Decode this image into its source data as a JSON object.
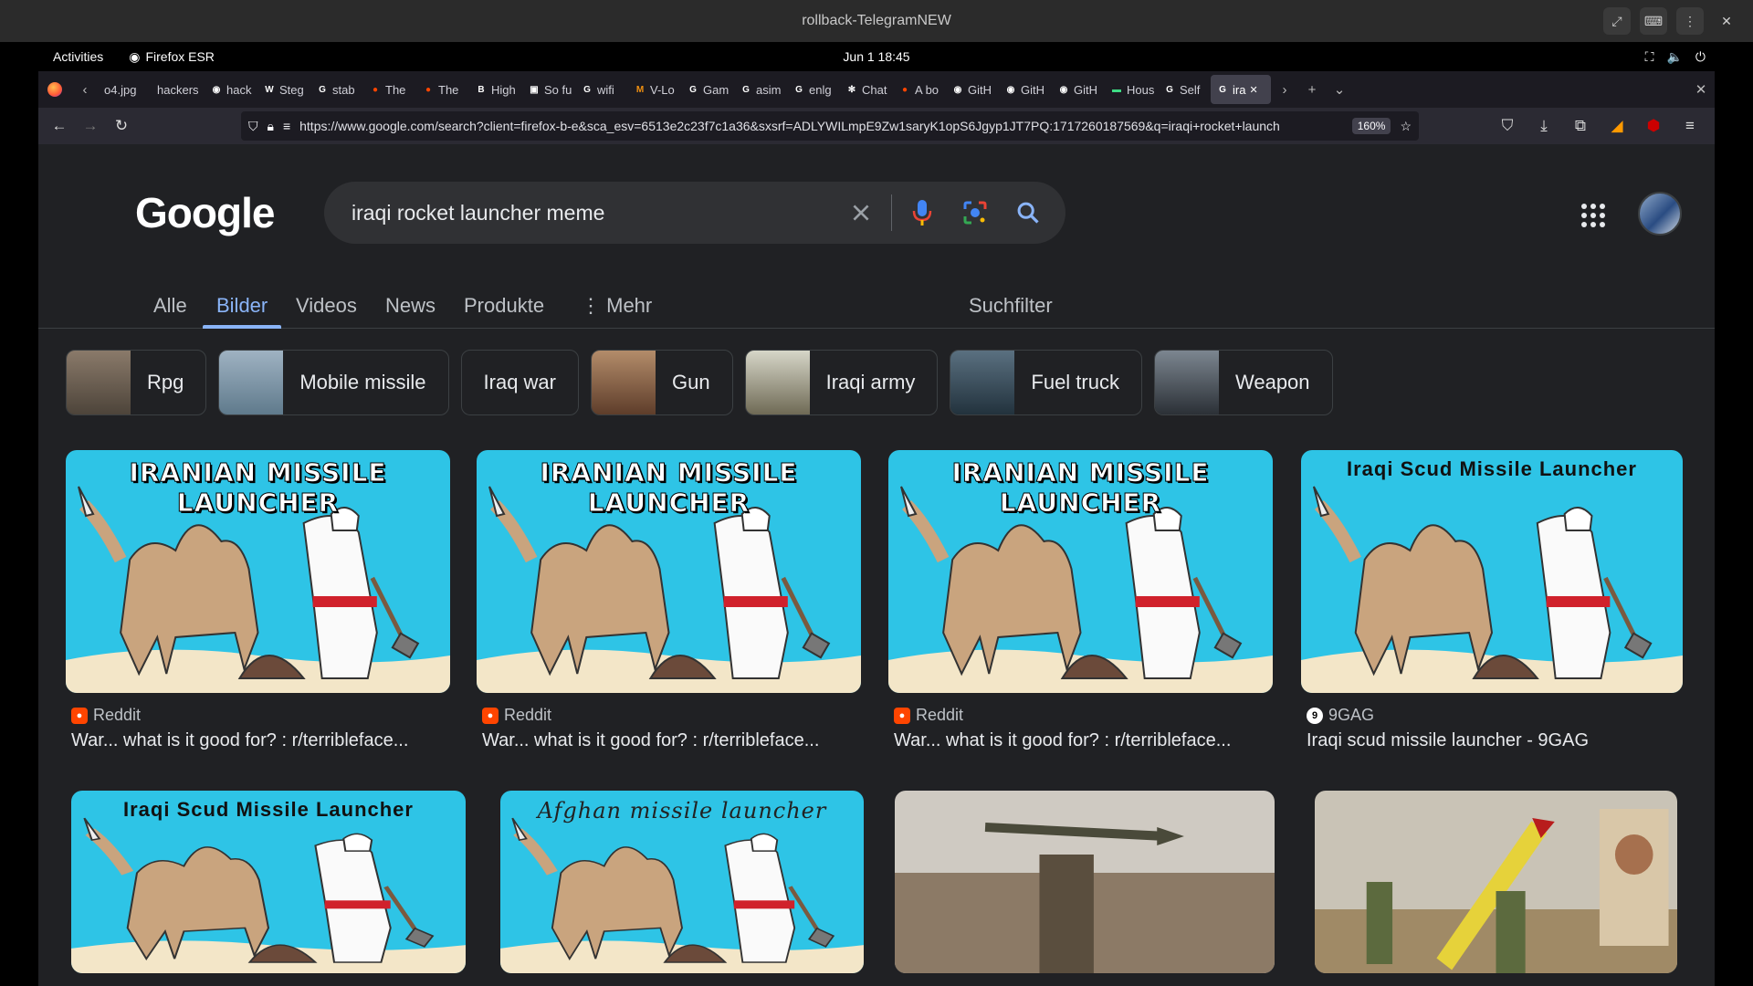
{
  "window": {
    "title": "rollback-TelegramNEW"
  },
  "gnome": {
    "activities": "Activities",
    "app": "Firefox ESR",
    "clock": "Jun 1  18:45"
  },
  "browser": {
    "tabs": [
      {
        "label": "o4.jpg",
        "icon": "image-icon",
        "color": "#9aa0a6"
      },
      {
        "label": "hackers",
        "icon": "generic-icon",
        "color": "#9aa0a6"
      },
      {
        "label": "hack",
        "icon": "github-icon",
        "color": "#ffffff"
      },
      {
        "label": "Steg",
        "icon": "wikipedia-icon",
        "color": "#ffffff"
      },
      {
        "label": "stab",
        "icon": "google-icon",
        "color": "#ffffff"
      },
      {
        "label": "The",
        "icon": "reddit-icon",
        "color": "#ff4500"
      },
      {
        "label": "The",
        "icon": "reddit-icon",
        "color": "#ff4500"
      },
      {
        "label": "High",
        "icon": "br-icon",
        "color": "#ffffff"
      },
      {
        "label": "So fu",
        "icon": "bookmark-icon",
        "color": "#ffffff"
      },
      {
        "label": "wifi",
        "icon": "google-icon",
        "color": "#ffffff"
      },
      {
        "label": "V-Lo",
        "icon": "m-icon",
        "color": "#f29111"
      },
      {
        "label": "Gam",
        "icon": "google-icon",
        "color": "#ffffff"
      },
      {
        "label": "asim",
        "icon": "google-icon",
        "color": "#ffffff"
      },
      {
        "label": "enlg",
        "icon": "google-icon",
        "color": "#ffffff"
      },
      {
        "label": "Chat",
        "icon": "chatgpt-icon",
        "color": "#ffffff"
      },
      {
        "label": "A bo",
        "icon": "reddit-icon",
        "color": "#ff4500"
      },
      {
        "label": "GitH",
        "icon": "github-icon",
        "color": "#ffffff"
      },
      {
        "label": "GitH",
        "icon": "github-icon",
        "color": "#ffffff"
      },
      {
        "label": "GitH",
        "icon": "github-icon",
        "color": "#ffffff"
      },
      {
        "label": "Hous",
        "icon": "android-icon",
        "color": "#3ddc84"
      },
      {
        "label": "Self",
        "icon": "google-icon",
        "color": "#ffffff"
      },
      {
        "label": "ira",
        "icon": "google-icon",
        "color": "#ffffff",
        "active": true
      }
    ],
    "url": "https://www.google.com/search?client=firefox-b-e&sca_esv=6513e2c23f7c1a36&sxsrf=ADLYWILmpE9Zw1saryK1opS6Jgyp1JT7PQ:1717260187569&q=iraqi+rocket+launch",
    "zoom": "160%"
  },
  "google": {
    "logo": "Google",
    "query": "iraqi rocket launcher meme",
    "tabs": [
      "Alle",
      "Bilder",
      "Videos",
      "News",
      "Produkte",
      "Mehr"
    ],
    "active_tab": "Bilder",
    "filter": "Suchfilter",
    "chips": [
      {
        "label": "Rpg",
        "thumb": true
      },
      {
        "label": "Mobile missile",
        "thumb": true
      },
      {
        "label": "Iraq war",
        "thumb": false
      },
      {
        "label": "Gun",
        "thumb": true
      },
      {
        "label": "Iraqi army",
        "thumb": true
      },
      {
        "label": "Fuel truck",
        "thumb": true
      },
      {
        "label": "Weapon",
        "thumb": true
      }
    ],
    "results": [
      {
        "caption": "IRANIAN MISSILE LAUNCHER",
        "source": "Reddit",
        "title": "War... what is it good for? : r/terribleface..."
      },
      {
        "caption": "IRANIAN MISSILE LAUNCHER",
        "source": "Reddit",
        "title": "War... what is it good for? : r/terribleface..."
      },
      {
        "caption": "IRANIAN MISSILE LAUNCHER",
        "source": "Reddit",
        "title": "War... what is it good for? : r/terribleface..."
      },
      {
        "caption": "Iraqi Scud Missile Launcher",
        "source": "9GAG",
        "title": "Iraqi scud missile launcher - 9GAG"
      },
      {
        "caption": "Iraqi Scud Missile Launcher"
      },
      {
        "caption": "Afghan missile launcher"
      },
      {
        "caption": ""
      },
      {
        "caption": ""
      }
    ]
  }
}
